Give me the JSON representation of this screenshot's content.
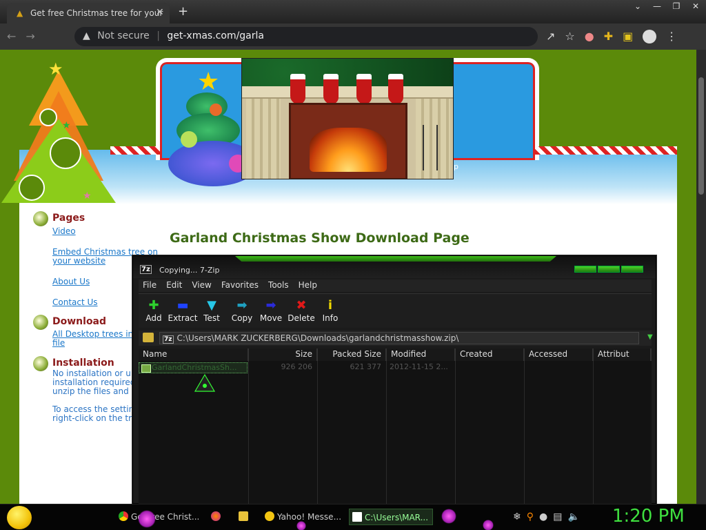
{
  "browser": {
    "tab_title": "Get free Christmas tree for your",
    "new_tab": "+",
    "omnibox": {
      "security_label": "Not secure",
      "url": "get-xmas.com/garla"
    }
  },
  "page": {
    "title": "Garland Christmas Show Download Page",
    "fireplace_side_text": "p",
    "nav": {
      "pages": {
        "heading": "Pages",
        "links": [
          "Video",
          "Embed Christmas tree on",
          "your website",
          "About Us",
          "Contact Us"
        ]
      },
      "download": {
        "heading": "Download",
        "links": [
          "All Desktop trees in s",
          "file"
        ]
      },
      "installation": {
        "heading": "Installation",
        "text": [
          "No installation or un-",
          "installation required,",
          "unzip the files and ru",
          "",
          "To access the setting",
          "right-click on the tre"
        ]
      }
    }
  },
  "zip": {
    "title": "Copying... 7-Zip",
    "icon_label": "7z",
    "menu": [
      "File",
      "Edit",
      "View",
      "Favorites",
      "Tools",
      "Help"
    ],
    "toolbar": [
      {
        "label": "Add",
        "icon": "plus-icon",
        "glyph": "✚",
        "color": "#2ed12e"
      },
      {
        "label": "Extract",
        "icon": "minus-icon",
        "glyph": "▬",
        "color": "#1f43ff"
      },
      {
        "label": "Test",
        "icon": "check-icon",
        "glyph": "▼",
        "color": "#27c8e8"
      },
      {
        "label": "Copy",
        "icon": "copy-arrow-icon",
        "glyph": "➡",
        "color": "#1fa0c0"
      },
      {
        "label": "Move",
        "icon": "move-arrow-icon",
        "glyph": "➡",
        "color": "#2b2bd8"
      },
      {
        "label": "Delete",
        "icon": "delete-x-icon",
        "glyph": "✖",
        "color": "#e01919"
      },
      {
        "label": "Info",
        "icon": "info-icon",
        "glyph": "i",
        "color": "#f1d900"
      }
    ],
    "path": "C:\\Users\\MARK ZUCKERBERG\\Downloads\\garlandchristmasshow.zip\\",
    "columns": [
      "Name",
      "Size",
      "Packed Size",
      "Modified",
      "Created",
      "Accessed",
      "Attribut"
    ],
    "rows": [
      {
        "name": "GarlandChristmasSh...",
        "size": "926 206",
        "packed": "621 377",
        "modified": "2012-11-15 2..."
      }
    ]
  },
  "taskbar": {
    "items": [
      {
        "label": "Get free Christ...",
        "icon": "chrome-icon"
      },
      {
        "label": "",
        "icon": "firefox-icon"
      },
      {
        "label": "",
        "icon": "folder-icon"
      },
      {
        "label": "Yahoo! Messe...",
        "icon": "yahoo-messenger-icon"
      },
      {
        "label": "C:\\Users\\MAR...",
        "icon": "7zip-icon"
      }
    ],
    "clock": "1:20 PM"
  },
  "colors": {
    "page_bg": "#5b8a0a",
    "title_green": "#3d6a16",
    "nav_red": "#8b1a1a",
    "link_blue": "#1a77c9",
    "clock_green": "#3fe03f"
  }
}
